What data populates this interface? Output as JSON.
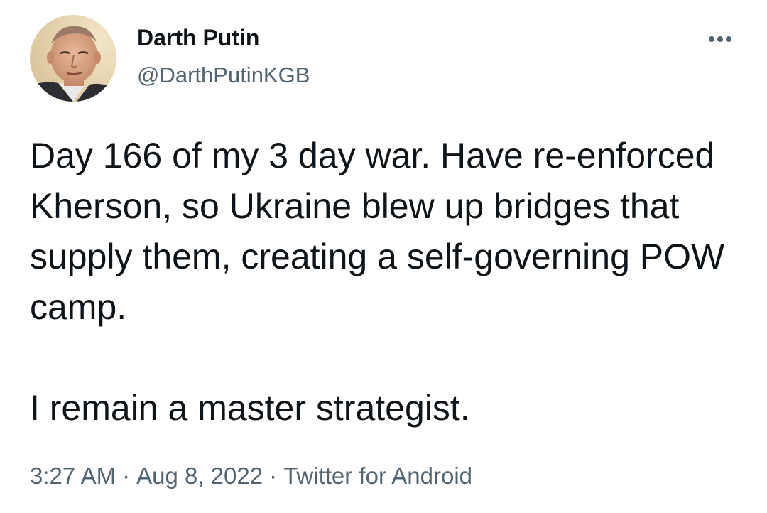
{
  "author": {
    "display_name": "Darth Putin",
    "handle": "@DarthPutinKGB"
  },
  "tweet": {
    "paragraphs": [
      "Day 166 of my 3 day war. Have re-enforced Kherson, so Ukraine blew up bridges that supply them, creating a self-governing POW camp.",
      "I remain a master strategist."
    ]
  },
  "meta": {
    "time": "3:27 AM",
    "separator": "·",
    "date": "Aug 8, 2022",
    "source": "Twitter for Android"
  },
  "icons": {
    "avatar": "profile-photo",
    "more": "more-horizontal-icon"
  },
  "colors": {
    "text_primary": "#0f1419",
    "text_secondary": "#536471",
    "background": "#ffffff"
  }
}
